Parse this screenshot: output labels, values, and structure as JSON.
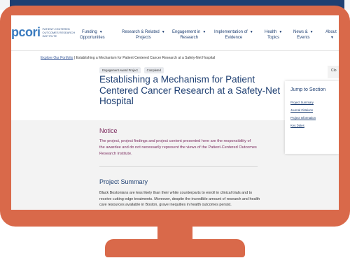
{
  "nav": {
    "logo": "pcori",
    "logo_subtitle": "PATIENT-CENTERED OUTCOMES RESEARCH INSTITUTE",
    "items": [
      {
        "line1": "Funding",
        "line2": "Opportunities"
      },
      {
        "line1": "Research & Related",
        "line2": "Projects"
      },
      {
        "line1": "Engagement in",
        "line2": "Research"
      },
      {
        "line1": "Implementation of",
        "line2": "Evidence"
      },
      {
        "line1": "Health",
        "line2": "Topics"
      },
      {
        "line1": "News &",
        "line2": "Events"
      },
      {
        "line1": "About",
        "line2": ""
      }
    ]
  },
  "breadcrumb": {
    "link": "Explore Our Portfolio",
    "separator": "|",
    "current": "Establishing a Mechanism for Patient Centered Cancer Research at a Safety-Net Hospital"
  },
  "tags": [
    "Engagement Award Project",
    "Completed"
  ],
  "title": "Establishing a Mechanism for Patient Centered Cancer Research at a Safety-Net Hospital",
  "close_label": "Clo",
  "jump": {
    "title": "Jump to Section",
    "links": [
      "Project Summary",
      "Journal Citations",
      "Project Information",
      "Key Dates"
    ]
  },
  "notice": {
    "heading": "Notice",
    "body": "The project, project findings and project content presented here are the responsibility of the awardee and do not necessarily represent the views of the Patient-Centered Outcomes Research Institute."
  },
  "summary": {
    "heading": "Project Summary",
    "body": "Black Bostonians are less likely than their white counterparts to enroll in clinical trials and to receive cutting edge treatments. Moreover, despite the incredible amount of research and health care resources available in Boston, grave inequities in health outcomes persist."
  }
}
